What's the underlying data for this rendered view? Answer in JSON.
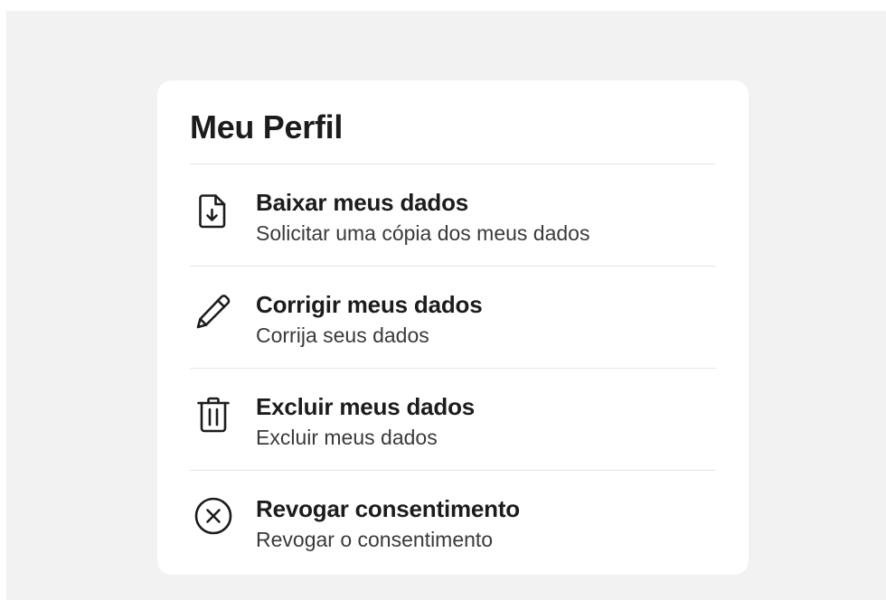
{
  "profile": {
    "title": "Meu Perfil",
    "items": [
      {
        "icon": "download-document-icon",
        "label": "Baixar meus dados",
        "description": "Solicitar uma cópia dos meus dados"
      },
      {
        "icon": "pencil-icon",
        "label": "Corrigir meus dados",
        "description": "Corrija seus dados"
      },
      {
        "icon": "trash-icon",
        "label": "Excluir meus dados",
        "description": "Excluir meus dados"
      },
      {
        "icon": "close-circle-icon",
        "label": "Revogar consentimento",
        "description": "Revogar o consentimento"
      }
    ]
  },
  "colors": {
    "background": "#f2f2f2",
    "card": "#ffffff",
    "text_primary": "#1c1c1e",
    "text_secondary": "#3a3a3c",
    "divider": "#e6e6e8"
  }
}
